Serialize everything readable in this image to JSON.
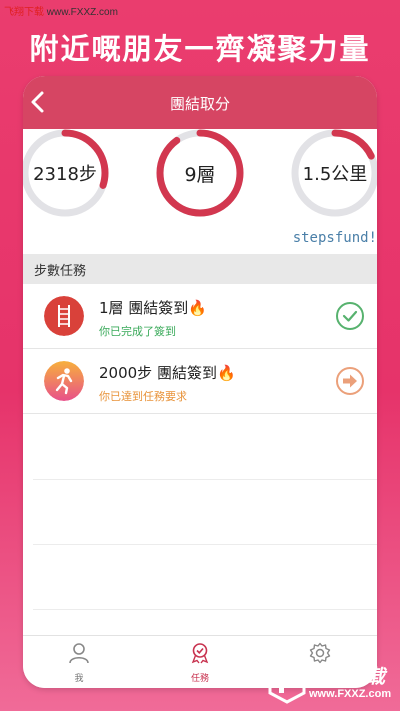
{
  "watermark_top": {
    "part1": "飞翔下载",
    "part2": " www.FXXZ.com"
  },
  "headline": "附近嘅朋友一齊凝聚力量",
  "nav": {
    "title": "團結取分"
  },
  "rings": [
    {
      "value": "2318步",
      "progress": 0.3
    },
    {
      "value": "9層",
      "progress": 0.9
    },
    {
      "value": "1.5公里",
      "progress": 0.18
    }
  ],
  "watermark_en": "stepsfund!",
  "section": {
    "title": "步數任務"
  },
  "tasks": [
    {
      "title": "1層 團結簽到🔥",
      "status": "你已完成了簽到",
      "status_color": "#3aaa5a",
      "icon": "ladder-icon",
      "action": "check-circle-icon"
    },
    {
      "title": "2000步 團結簽到🔥",
      "status": "你已達到任務要求",
      "status_color": "#e8933a",
      "icon": "runner-icon",
      "action": "arrow-right-circle-icon"
    }
  ],
  "tabs": [
    {
      "label": "我",
      "icon": "person-icon",
      "active": false
    },
    {
      "label": "任務",
      "icon": "badge-icon",
      "active": true
    },
    {
      "label": "",
      "icon": "gear-icon",
      "active": false
    }
  ],
  "watermark_br": {
    "cn": "飞翔下载",
    "en": "www.FXXZ.com"
  },
  "colors": {
    "accent": "#d64563",
    "ring_track": "#e2e2e6",
    "ring_fill": "#d2374f"
  }
}
